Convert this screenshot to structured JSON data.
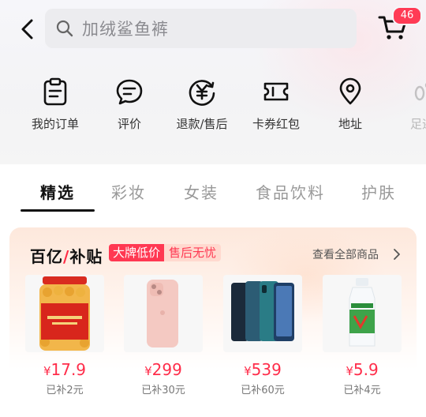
{
  "header": {
    "search_placeholder": "加绒鲨鱼裤",
    "cart_count": "46"
  },
  "quick_actions": [
    {
      "label": "我的订单",
      "icon": "clipboard-icon"
    },
    {
      "label": "评价",
      "icon": "comment-icon"
    },
    {
      "label": "退款/售后",
      "icon": "refund-yen-icon"
    },
    {
      "label": "卡券红包",
      "icon": "ticket-icon"
    },
    {
      "label": "地址",
      "icon": "location-pin-icon"
    },
    {
      "label": "足迹",
      "icon": "footprint-icon"
    }
  ],
  "tabs": [
    "精选",
    "彩妆",
    "女装",
    "食品饮料",
    "护肤"
  ],
  "active_tab": "精选",
  "subsidy": {
    "brand_left": "百亿",
    "brand_right": "补贴",
    "tag_main": "大牌低价",
    "tag_sub": "售后无忧",
    "view_all": "查看全部商品",
    "products": [
      {
        "currency": "¥",
        "price": "17.9",
        "subsidy": "已补2元",
        "image": "snack-jar"
      },
      {
        "currency": "¥",
        "price": "299",
        "subsidy": "已补30元",
        "image": "pink-phone"
      },
      {
        "currency": "¥",
        "price": "539",
        "subsidy": "已补60元",
        "image": "android-phones"
      },
      {
        "currency": "¥",
        "price": "5.9",
        "subsidy": "已补4元",
        "image": "milk-drink-bottle"
      }
    ]
  },
  "colors": {
    "accent_red": "#ff2d4a",
    "badge": "#ff3b55"
  }
}
